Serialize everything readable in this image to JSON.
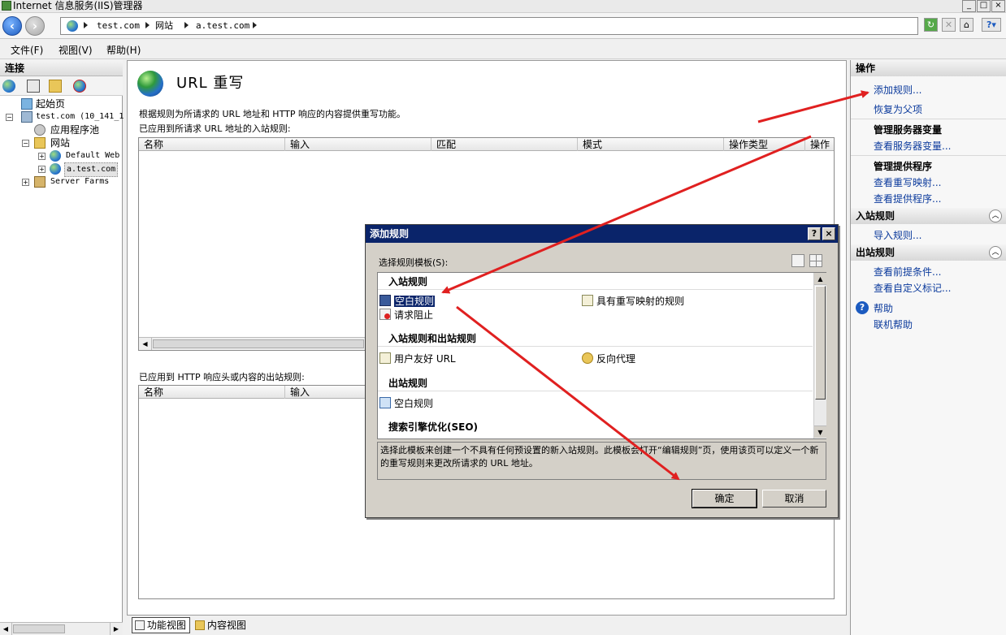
{
  "window": {
    "title": "Internet 信息服务(IIS)管理器"
  },
  "address": {
    "crumbs": [
      "test.com",
      "网站",
      "a.test.com"
    ]
  },
  "menu": [
    "文件(F)",
    "视图(V)",
    "帮助(H)"
  ],
  "left": {
    "header": "连接",
    "tree": [
      "起始页",
      "test.com (10_141_1",
      "应用程序池",
      "网站",
      "Default Web",
      "a.test.com",
      "Server Farms"
    ]
  },
  "center": {
    "title": "URL 重写",
    "description": "根据规则为所请求的 URL 地址和 HTTP 响应的内容提供重写功能。",
    "inbound_label": "已应用到所请求 URL 地址的入站规则:",
    "inbound_columns": [
      "名称",
      "输入",
      "匹配",
      "模式",
      "操作类型",
      "操作"
    ],
    "outbound_label": "已应用到 HTTP 响应头或内容的出站规则:",
    "outbound_columns": [
      "名称",
      "输入"
    ]
  },
  "views": {
    "feature": "功能视图",
    "content": "内容视图"
  },
  "right": {
    "header": "操作",
    "add_rule": "添加规则...",
    "revert": "恢复为父项",
    "manage_server_vars": "管理服务器变量",
    "view_server_vars": "查看服务器变量...",
    "manage_providers": "管理提供程序",
    "view_rewrite_maps": "查看重写映射...",
    "view_providers": "查看提供程序...",
    "inbound_header": "入站规则",
    "import_rules": "导入规则...",
    "outbound_header": "出站规则",
    "view_preconditions": "查看前提条件...",
    "view_custom_tags": "查看自定义标记...",
    "help": "帮助",
    "online_help": "联机帮助"
  },
  "dialog": {
    "title": "添加规则",
    "help_btn": "?",
    "close_btn": "×",
    "template_label": "选择规则模板(S):",
    "sections": {
      "inbound": "入站规则",
      "in_out": "入站规则和出站规则",
      "outbound": "出站规则",
      "seo": "搜索引擎优化(SEO)"
    },
    "items": {
      "blank_rule": "空白规则",
      "rule_with_map": "具有重写映射的规则",
      "request_block": "请求阻止",
      "friendly_url": "用户友好 URL",
      "reverse_proxy": "反向代理",
      "outbound_blank": "空白规则"
    },
    "description": "选择此模板来创建一个不具有任何预设置的新入站规则。此模板会打开“编辑规则”页，使用该页可以定义一个新的重写规则来更改所请求的 URL 地址。",
    "ok": "确定",
    "cancel": "取消"
  },
  "colors": {
    "selection": "#0a246a",
    "annotation_arrow": "#e02020",
    "link": "#0b3a9c"
  }
}
